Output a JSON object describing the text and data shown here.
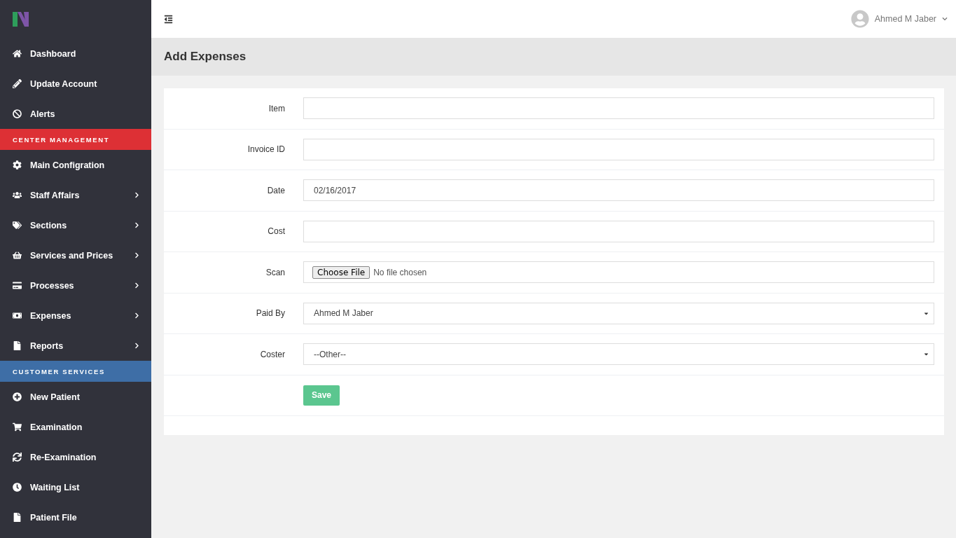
{
  "sidebar": {
    "items": [
      {
        "kind": "item",
        "label": "Dashboard",
        "expandable": false
      },
      {
        "kind": "item",
        "label": "Update Account",
        "expandable": false
      },
      {
        "kind": "item",
        "label": "Alerts",
        "expandable": false
      },
      {
        "kind": "header",
        "label": "CENTER MANAGEMENT",
        "color": "#dd3035"
      },
      {
        "kind": "item",
        "label": "Main Configration",
        "expandable": false
      },
      {
        "kind": "item",
        "label": "Staff Affairs",
        "expandable": true
      },
      {
        "kind": "item",
        "label": "Sections",
        "expandable": true
      },
      {
        "kind": "item",
        "label": "Services and Prices",
        "expandable": true
      },
      {
        "kind": "item",
        "label": "Processes",
        "expandable": true
      },
      {
        "kind": "item",
        "label": "Expenses",
        "expandable": true
      },
      {
        "kind": "item",
        "label": "Reports",
        "expandable": true
      },
      {
        "kind": "header",
        "label": "CUSTOMER SERVICES",
        "color": "#3e6ea6"
      },
      {
        "kind": "item",
        "label": "New Patient",
        "expandable": false
      },
      {
        "kind": "item",
        "label": "Examination",
        "expandable": false
      },
      {
        "kind": "item",
        "label": "Re-Examination",
        "expandable": false
      },
      {
        "kind": "item",
        "label": "Waiting List",
        "expandable": false
      },
      {
        "kind": "item",
        "label": "Patient File",
        "expandable": false
      }
    ]
  },
  "topbar": {
    "user_name": "Ahmed M Jaber"
  },
  "page_title": "Add Expenses",
  "form": {
    "fields": [
      {
        "kind": "text",
        "label": "Item"
      },
      {
        "kind": "text",
        "label": "Invoice ID"
      },
      {
        "kind": "text",
        "label": "Date",
        "value": "02/16/2017"
      },
      {
        "kind": "text",
        "label": "Cost"
      },
      {
        "kind": "file",
        "label": "Scan",
        "button": "Choose File",
        "value": "No file chosen"
      },
      {
        "kind": "select",
        "label": "Paid By",
        "value": "Ahmed M Jaber"
      },
      {
        "kind": "select",
        "label": "Coster",
        "value": "--Other--"
      }
    ],
    "submit": "Save"
  }
}
